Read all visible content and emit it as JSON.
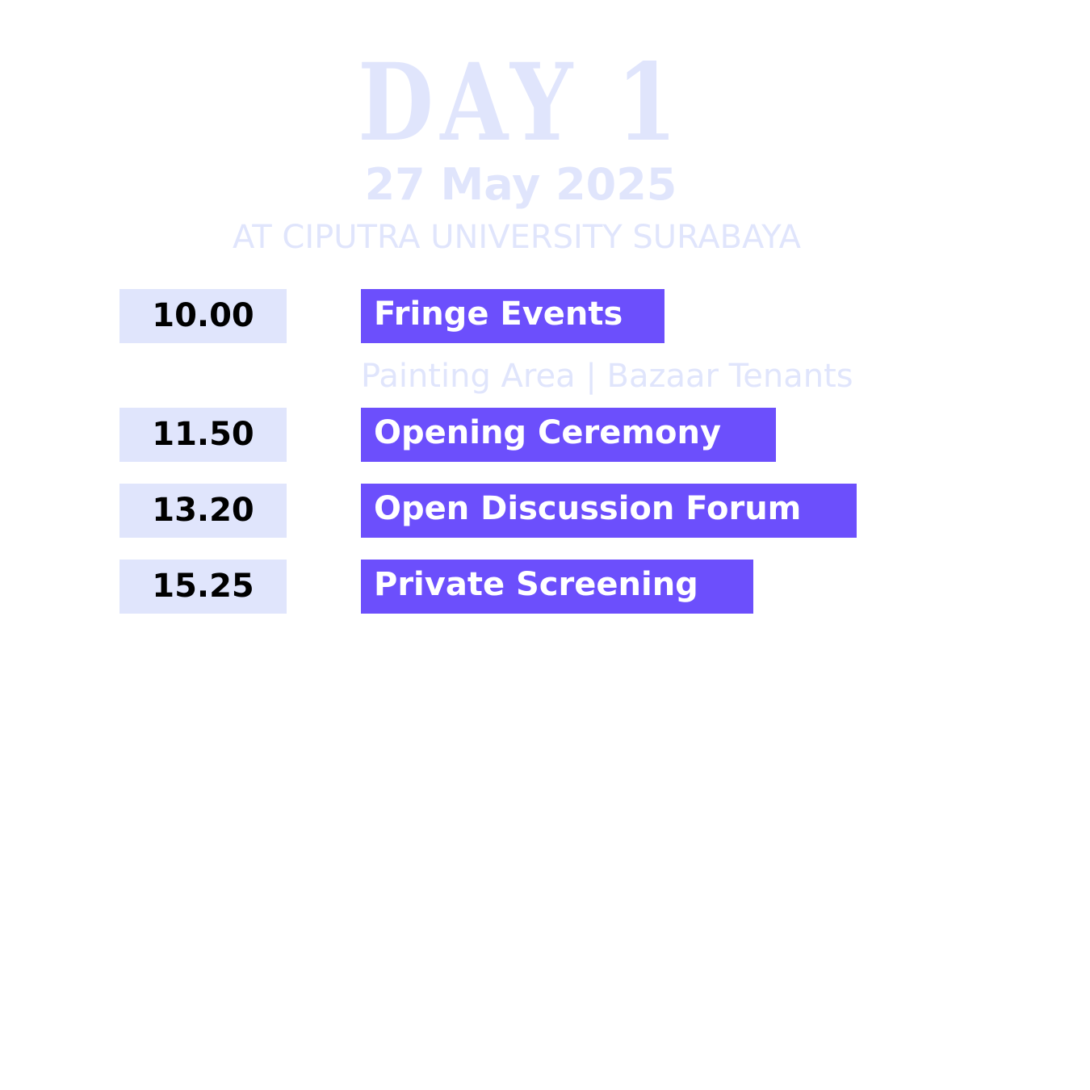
{
  "header": {
    "day_title": "DAY 1",
    "date": "27 May 2025",
    "venue": "AT CIPUTRA UNIVERSITY SURABAYA"
  },
  "schedule": [
    {
      "time": "10.00",
      "event": "Fringe Events",
      "note": "Painting Area | Bazaar Tenants"
    },
    {
      "time": "11.50",
      "event": "Opening Ceremony"
    },
    {
      "time": "13.20",
      "event": "Open Discussion Forum"
    },
    {
      "time": "15.25",
      "event": "Private Screening"
    }
  ],
  "colors": {
    "accent": "#6c4ffc",
    "pale": "#e0e5fc",
    "time_text": "#000000",
    "event_text": "#ffffff"
  }
}
